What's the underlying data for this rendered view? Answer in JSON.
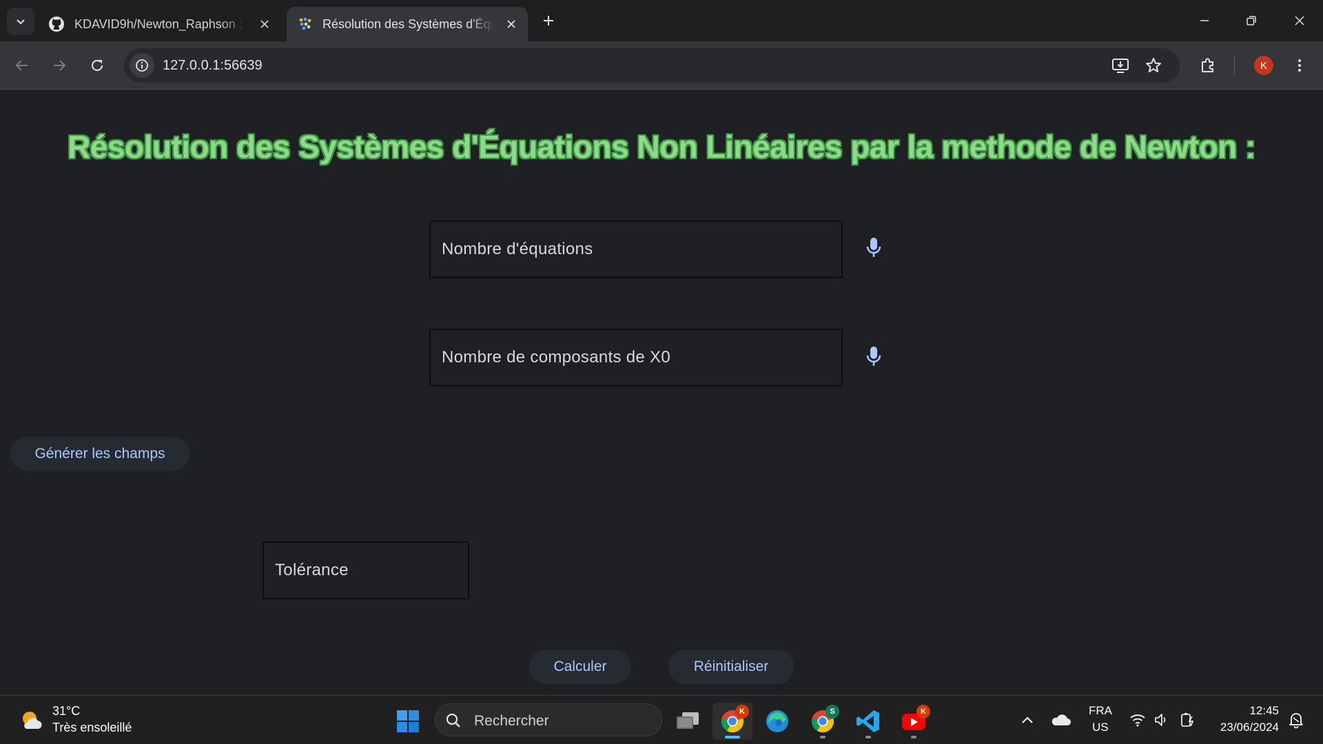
{
  "browser": {
    "tabs": [
      {
        "label": "KDAVID9h/Newton_Raphson : T",
        "icon": "github-icon",
        "active": false
      },
      {
        "label": "Résolution des Systèmes d'Équa",
        "icon": "app-favicon-icon",
        "active": true
      }
    ],
    "url": "127.0.0.1:56639",
    "profile_initial": "K"
  },
  "page": {
    "title": "Résolution des Systèmes d'Équations Non Linéaires par la methode de Newton :",
    "fields": {
      "equations_placeholder": "Nombre d'équations",
      "components_placeholder": "Nombre de composants de X0",
      "tolerance_placeholder": "Tolérance"
    },
    "buttons": {
      "generate": "Générer les champs",
      "compute": "Calculer",
      "reset": "Réinitialiser"
    }
  },
  "taskbar": {
    "weather": {
      "temperature": "31°C",
      "description": "Très ensoleillé"
    },
    "search_placeholder": "Rechercher",
    "apps": [
      {
        "name": "task-view",
        "badge": ""
      },
      {
        "name": "chrome",
        "badge": "K",
        "badge_color": "#d83b01",
        "active": true
      },
      {
        "name": "edge",
        "badge": ""
      },
      {
        "name": "chrome-profile-s",
        "badge": "S",
        "badge_color": "#0f7b52"
      },
      {
        "name": "vscode",
        "badge": ""
      },
      {
        "name": "youtube",
        "badge": "K",
        "badge_color": "#d83b01"
      }
    ],
    "language": {
      "lang": "FRA",
      "layout": "US"
    },
    "clock": {
      "time": "12:45",
      "date": "23/06/2024"
    }
  },
  "colors": {
    "title_fill": "#8ed98a",
    "title_outline": "#3f9a45",
    "button_text": "#aac7ff",
    "mic_color": "#aac7ff",
    "page_background": "#1f2023"
  }
}
